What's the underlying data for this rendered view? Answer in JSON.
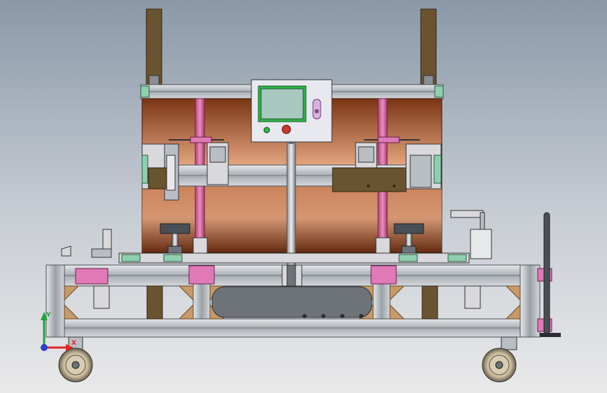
{
  "viewport": {
    "background_top": "#8a98a8",
    "background_bottom": "#e9e9ea"
  },
  "model": {
    "colors": {
      "profile": "#b9bec4",
      "profile_dark": "#6e7379",
      "drum_light": "#e2a07a",
      "drum_dark": "#6a2c12",
      "post": "#6a5330",
      "pink_rod": "#d36f9e",
      "green_cap": "#8fcfae",
      "plate": "#d9d9dd",
      "magenta_block": "#e07ab7",
      "tan_block": "#c79a6a",
      "control_screen": "#8cc08c",
      "indicator_green": "#2fb34a",
      "indicator_red": "#c8382c"
    },
    "control_panel": {
      "screen_icon": "display-screen-icon",
      "button_start": "green-button-icon",
      "button_stop": "red-button-icon",
      "switch": "key-switch-icon"
    }
  },
  "triad": {
    "x_label": "X",
    "y_label": "Y",
    "x_color": "#e0262b",
    "y_color": "#22a23a",
    "z_color": "#2d3fd1"
  }
}
